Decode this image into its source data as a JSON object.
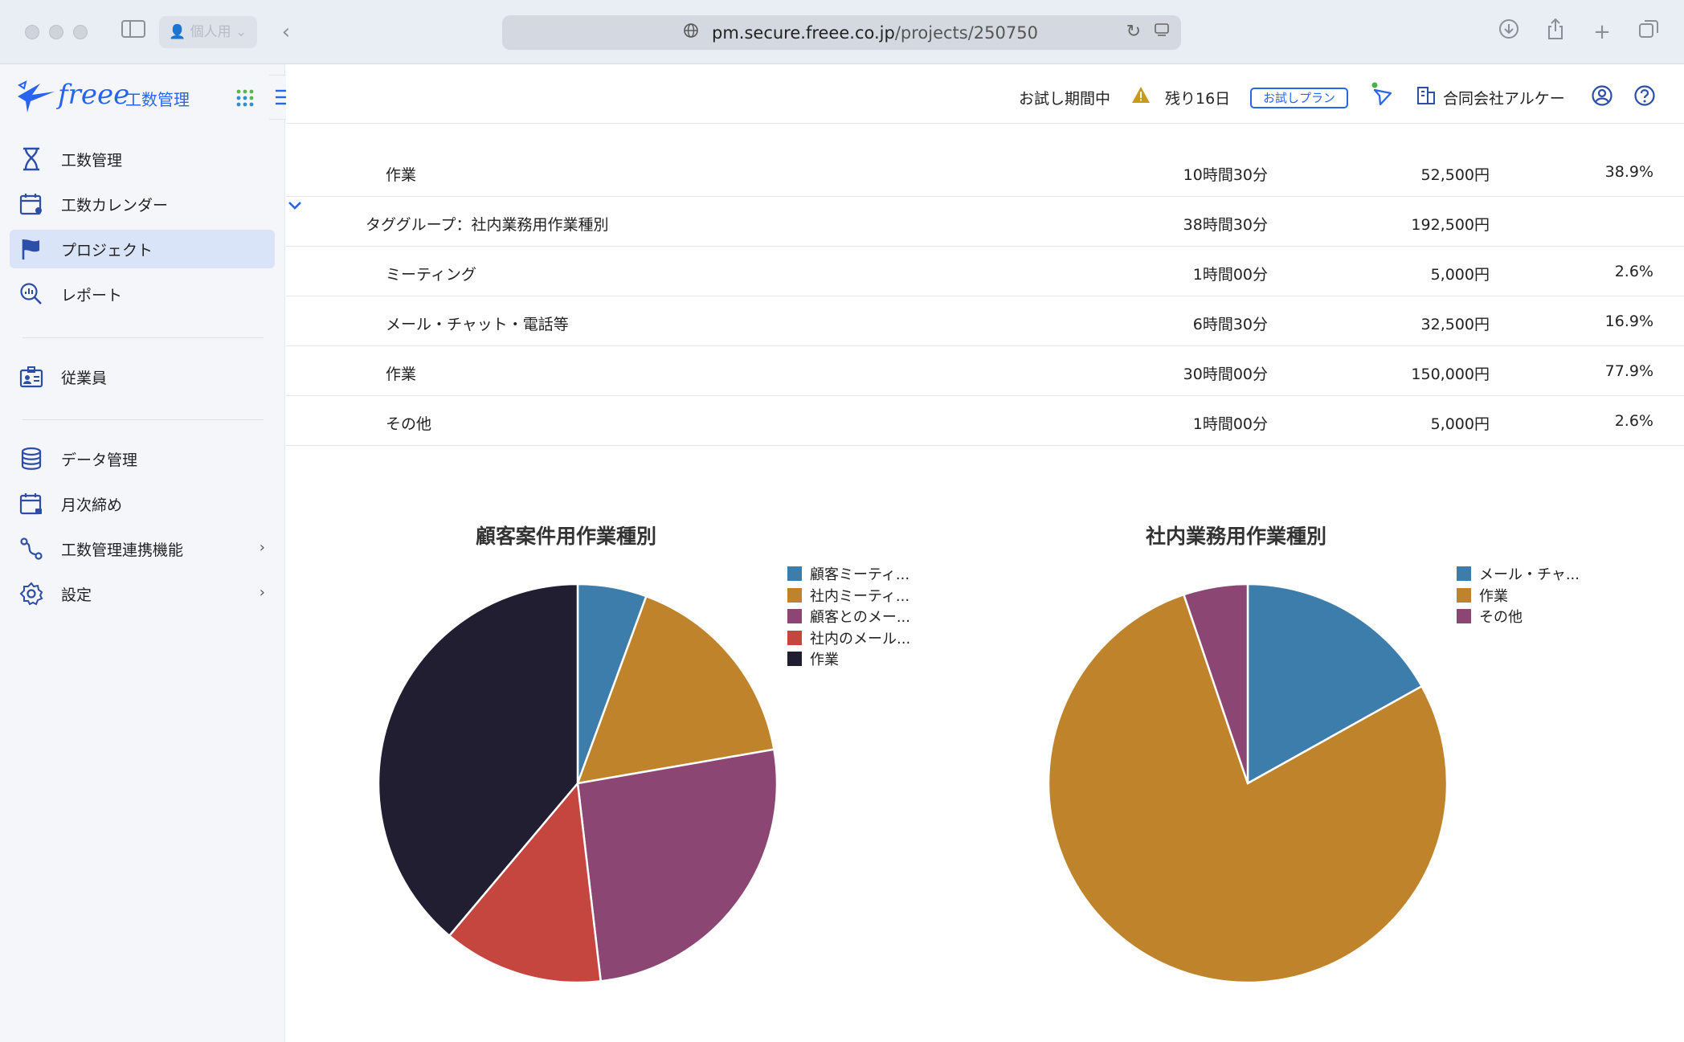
{
  "browser": {
    "profile_label": "個人用",
    "url_domain": "pm.secure.freee.co.jp",
    "url_path": "/projects/250750"
  },
  "sidebar": {
    "logo_text": "freee",
    "logo_sub": "工数管理",
    "items": [
      {
        "label": "工数管理",
        "icon": "hourglass-icon"
      },
      {
        "label": "工数カレンダー",
        "icon": "calendar-user-icon"
      },
      {
        "label": "プロジェクト",
        "icon": "flag-icon",
        "active": true
      },
      {
        "label": "レポート",
        "icon": "search-chart-icon"
      },
      {
        "label": "従業員",
        "icon": "id-card-icon"
      },
      {
        "label": "データ管理",
        "icon": "database-icon"
      },
      {
        "label": "月次締め",
        "icon": "calendar-lock-icon"
      },
      {
        "label": "工数管理連携機能",
        "icon": "integration-icon"
      },
      {
        "label": "設定",
        "icon": "gear-icon"
      }
    ]
  },
  "header": {
    "trial_status": "お試し期間中",
    "remaining": "残り16日",
    "plan_badge": "お試しプラン",
    "company": "合同会社アルケー"
  },
  "table": {
    "rows": [
      {
        "name": "作業",
        "time": "10時間30分",
        "cost": "52,500円",
        "pct": "38.9%"
      },
      {
        "name": "タググループ：社内業務用作業種別",
        "time": "38時間30分",
        "cost": "192,500円",
        "pct": "",
        "group": true
      },
      {
        "name": "ミーティング",
        "time": "1時間00分",
        "cost": "5,000円",
        "pct": "2.6%"
      },
      {
        "name": "メール・チャット・電話等",
        "time": "6時間30分",
        "cost": "32,500円",
        "pct": "16.9%"
      },
      {
        "name": "作業",
        "time": "30時間00分",
        "cost": "150,000円",
        "pct": "77.9%"
      },
      {
        "name": "その他",
        "time": "1時間00分",
        "cost": "5,000円",
        "pct": "2.6%"
      }
    ]
  },
  "chart_data": [
    {
      "type": "pie",
      "title": "顧客案件用作業種別",
      "legend_position": "right",
      "labels": [
        "顧客ミーティ...",
        "社内ミーティ...",
        "顧客とのメー...",
        "社内のメール...",
        "作業"
      ],
      "values": [
        5.6,
        16.7,
        25.9,
        13.0,
        38.9
      ],
      "colors": [
        "#3c7dab",
        "#bf842b",
        "#8b4674",
        "#c4463f",
        "#211e32"
      ]
    },
    {
      "type": "pie",
      "title": "社内業務用作業種別",
      "legend_position": "right",
      "labels": [
        "メール・チャ...",
        "作業",
        "その他"
      ],
      "values": [
        16.9,
        77.9,
        5.2
      ],
      "colors": [
        "#3c7dab",
        "#bf842b",
        "#8b4674"
      ]
    }
  ]
}
